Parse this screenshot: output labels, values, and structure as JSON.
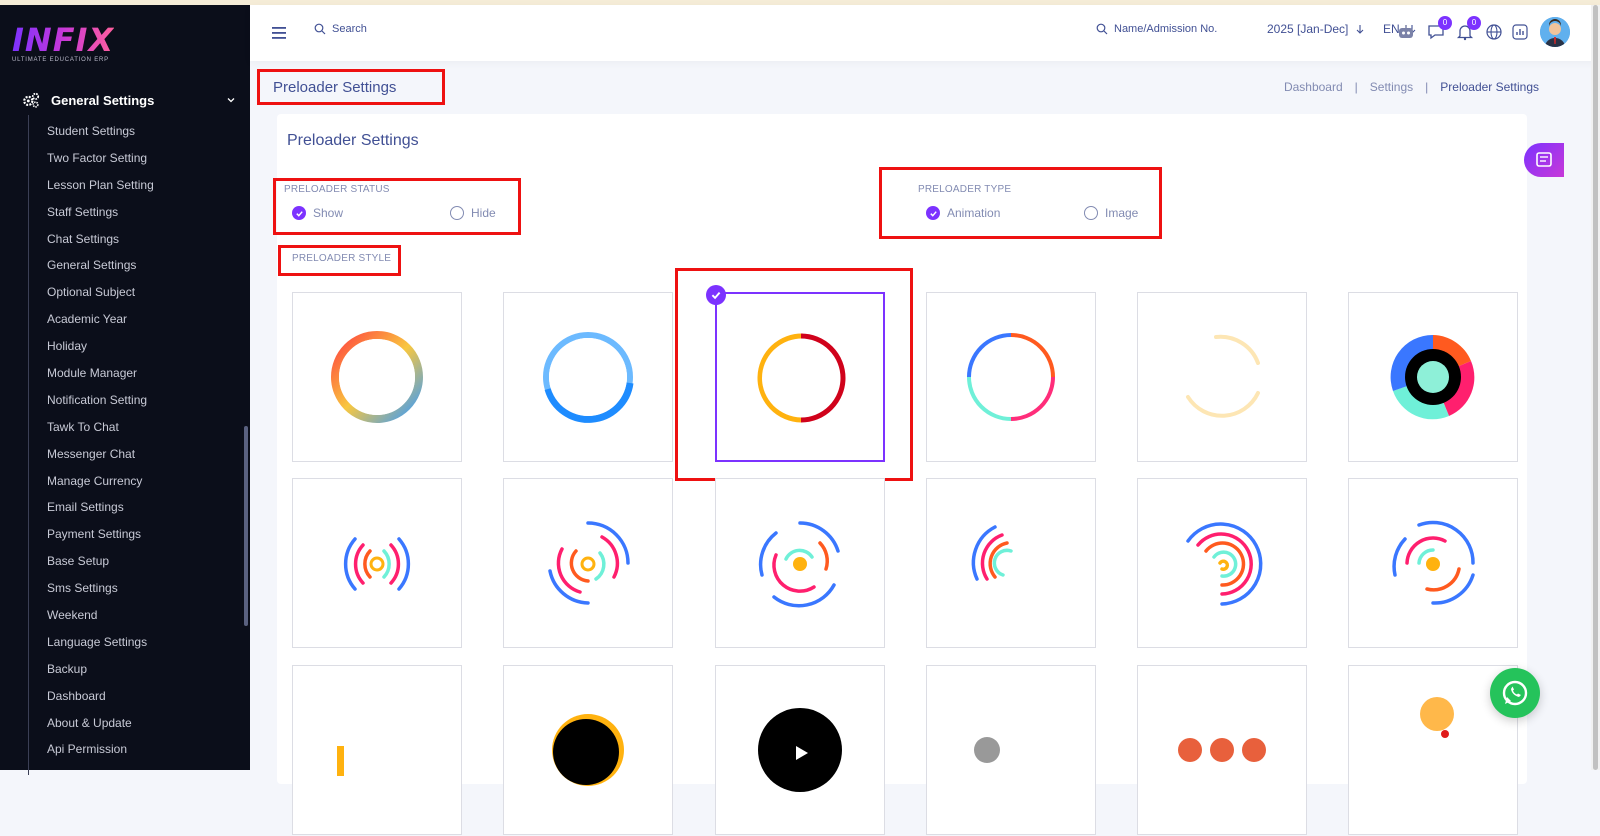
{
  "app": {
    "logo_text": "INFIX",
    "logo_sub": "ULTIMATE EDUCATION ERP"
  },
  "sidebar": {
    "section_label": "General Settings",
    "items": [
      "Student Settings",
      "Two Factor Setting",
      "Lesson Plan Setting",
      "Staff Settings",
      "Chat Settings",
      "General Settings",
      "Optional Subject",
      "Academic Year",
      "Holiday",
      "Module Manager",
      "Notification Setting",
      "Tawk To Chat",
      "Messenger Chat",
      "Manage Currency",
      "Email Settings",
      "Payment Settings",
      "Base Setup",
      "Sms Settings",
      "Weekend",
      "Language Settings",
      "Backup",
      "Dashboard",
      "About & Update",
      "Api Permission"
    ]
  },
  "header": {
    "search_label": "Search",
    "admission_label": "Name/Admission No.",
    "year_label": "2025 [Jan-Dec]",
    "language": "EN",
    "chat_badge": "0",
    "notification_badge": "0"
  },
  "page": {
    "title": "Preloader Settings",
    "breadcrumb": [
      "Dashboard",
      "|",
      "Settings",
      "|",
      "Preloader Settings"
    ]
  },
  "card": {
    "title": "Preloader Settings",
    "status": {
      "label": "PRELOADER STATUS",
      "options": [
        "Show",
        "Hide"
      ],
      "selected": "Show"
    },
    "type": {
      "label": "PRELOADER TYPE",
      "options": [
        "Animation",
        "Image"
      ],
      "selected": "Animation"
    },
    "style": {
      "label": "PRELOADER STYLE",
      "selected_index": 3
    }
  },
  "colors": {
    "accent": "#7c32ff",
    "highlight_box": "#ee1111",
    "text": "#415094",
    "muted": "#828bb2",
    "whatsapp": "#25c35b"
  }
}
